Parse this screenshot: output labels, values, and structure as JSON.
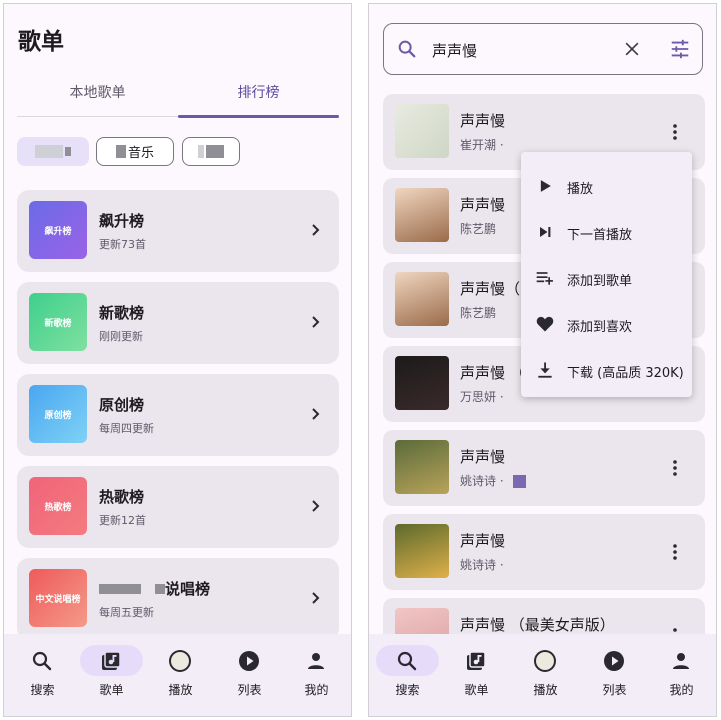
{
  "left": {
    "title": "歌单",
    "tabs": [
      {
        "label": "本地歌单"
      },
      {
        "label": "排行榜"
      }
    ],
    "chips": [
      {
        "label": ""
      },
      {
        "label": "音乐"
      },
      {
        "label": ""
      }
    ],
    "charts": [
      {
        "cover_text": "飙升榜",
        "name": "飙升榜",
        "sub": "更新73首",
        "color1": "#6a6be8",
        "color2": "#9a63e6"
      },
      {
        "cover_text": "新歌榜",
        "name": "新歌榜",
        "sub": "刚刚更新",
        "color1": "#3fcf8c",
        "color2": "#7fe0a0"
      },
      {
        "cover_text": "原创榜",
        "name": "原创榜",
        "sub": "每周四更新",
        "color1": "#49a7f0",
        "color2": "#7fd2f5"
      },
      {
        "cover_text": "热歌榜",
        "name": "热歌榜",
        "sub": "更新12首",
        "color1": "#f0647a",
        "color2": "#f47b7f"
      },
      {
        "cover_text": "中文说唱榜",
        "name": "说唱榜",
        "sub": "每周五更新",
        "color1": "#ef5a5a",
        "color2": "#f49a8a"
      }
    ],
    "nav": [
      {
        "label": "搜索",
        "icon": "search-icon"
      },
      {
        "label": "歌单",
        "icon": "playlist-icon"
      },
      {
        "label": "播放",
        "icon": "disc-icon"
      },
      {
        "label": "列表",
        "icon": "play-circle-icon"
      },
      {
        "label": "我的",
        "icon": "person-icon"
      }
    ]
  },
  "right": {
    "search": {
      "value": "声声慢"
    },
    "songs": [
      {
        "title": "声声慢",
        "artist": "崔开潮 · "
      },
      {
        "title": "声声慢",
        "artist": "陈艺鹏"
      },
      {
        "title": "声声慢（",
        "artist": "陈艺鹏"
      },
      {
        "title": "声声慢 （",
        "artist": "万思妍 · "
      },
      {
        "title": "声声慢",
        "artist": "姚诗诗 · "
      },
      {
        "title": "声声慢",
        "artist": "姚诗诗 · "
      },
      {
        "title": "声声慢 （最美女声版）",
        "artist": ""
      }
    ],
    "menu": [
      {
        "label": "播放",
        "icon": "play-icon"
      },
      {
        "label": "下一首播放",
        "icon": "skip-next-icon"
      },
      {
        "label": "添加到歌单",
        "icon": "playlist-add-icon"
      },
      {
        "label": "添加到喜欢",
        "icon": "heart-icon"
      },
      {
        "label": "下载 (高品质 320K)",
        "icon": "download-icon"
      }
    ],
    "nav": [
      {
        "label": "搜索",
        "icon": "search-icon"
      },
      {
        "label": "歌单",
        "icon": "playlist-icon"
      },
      {
        "label": "播放",
        "icon": "disc-icon"
      },
      {
        "label": "列表",
        "icon": "play-circle-icon"
      },
      {
        "label": "我的",
        "icon": "person-icon"
      }
    ],
    "active_nav": "搜索"
  },
  "colors": {
    "accent": "#6b5aa8",
    "card": "#ebe6ed",
    "nav_bg": "#f3edf7",
    "pill": "#e6dcfa"
  }
}
